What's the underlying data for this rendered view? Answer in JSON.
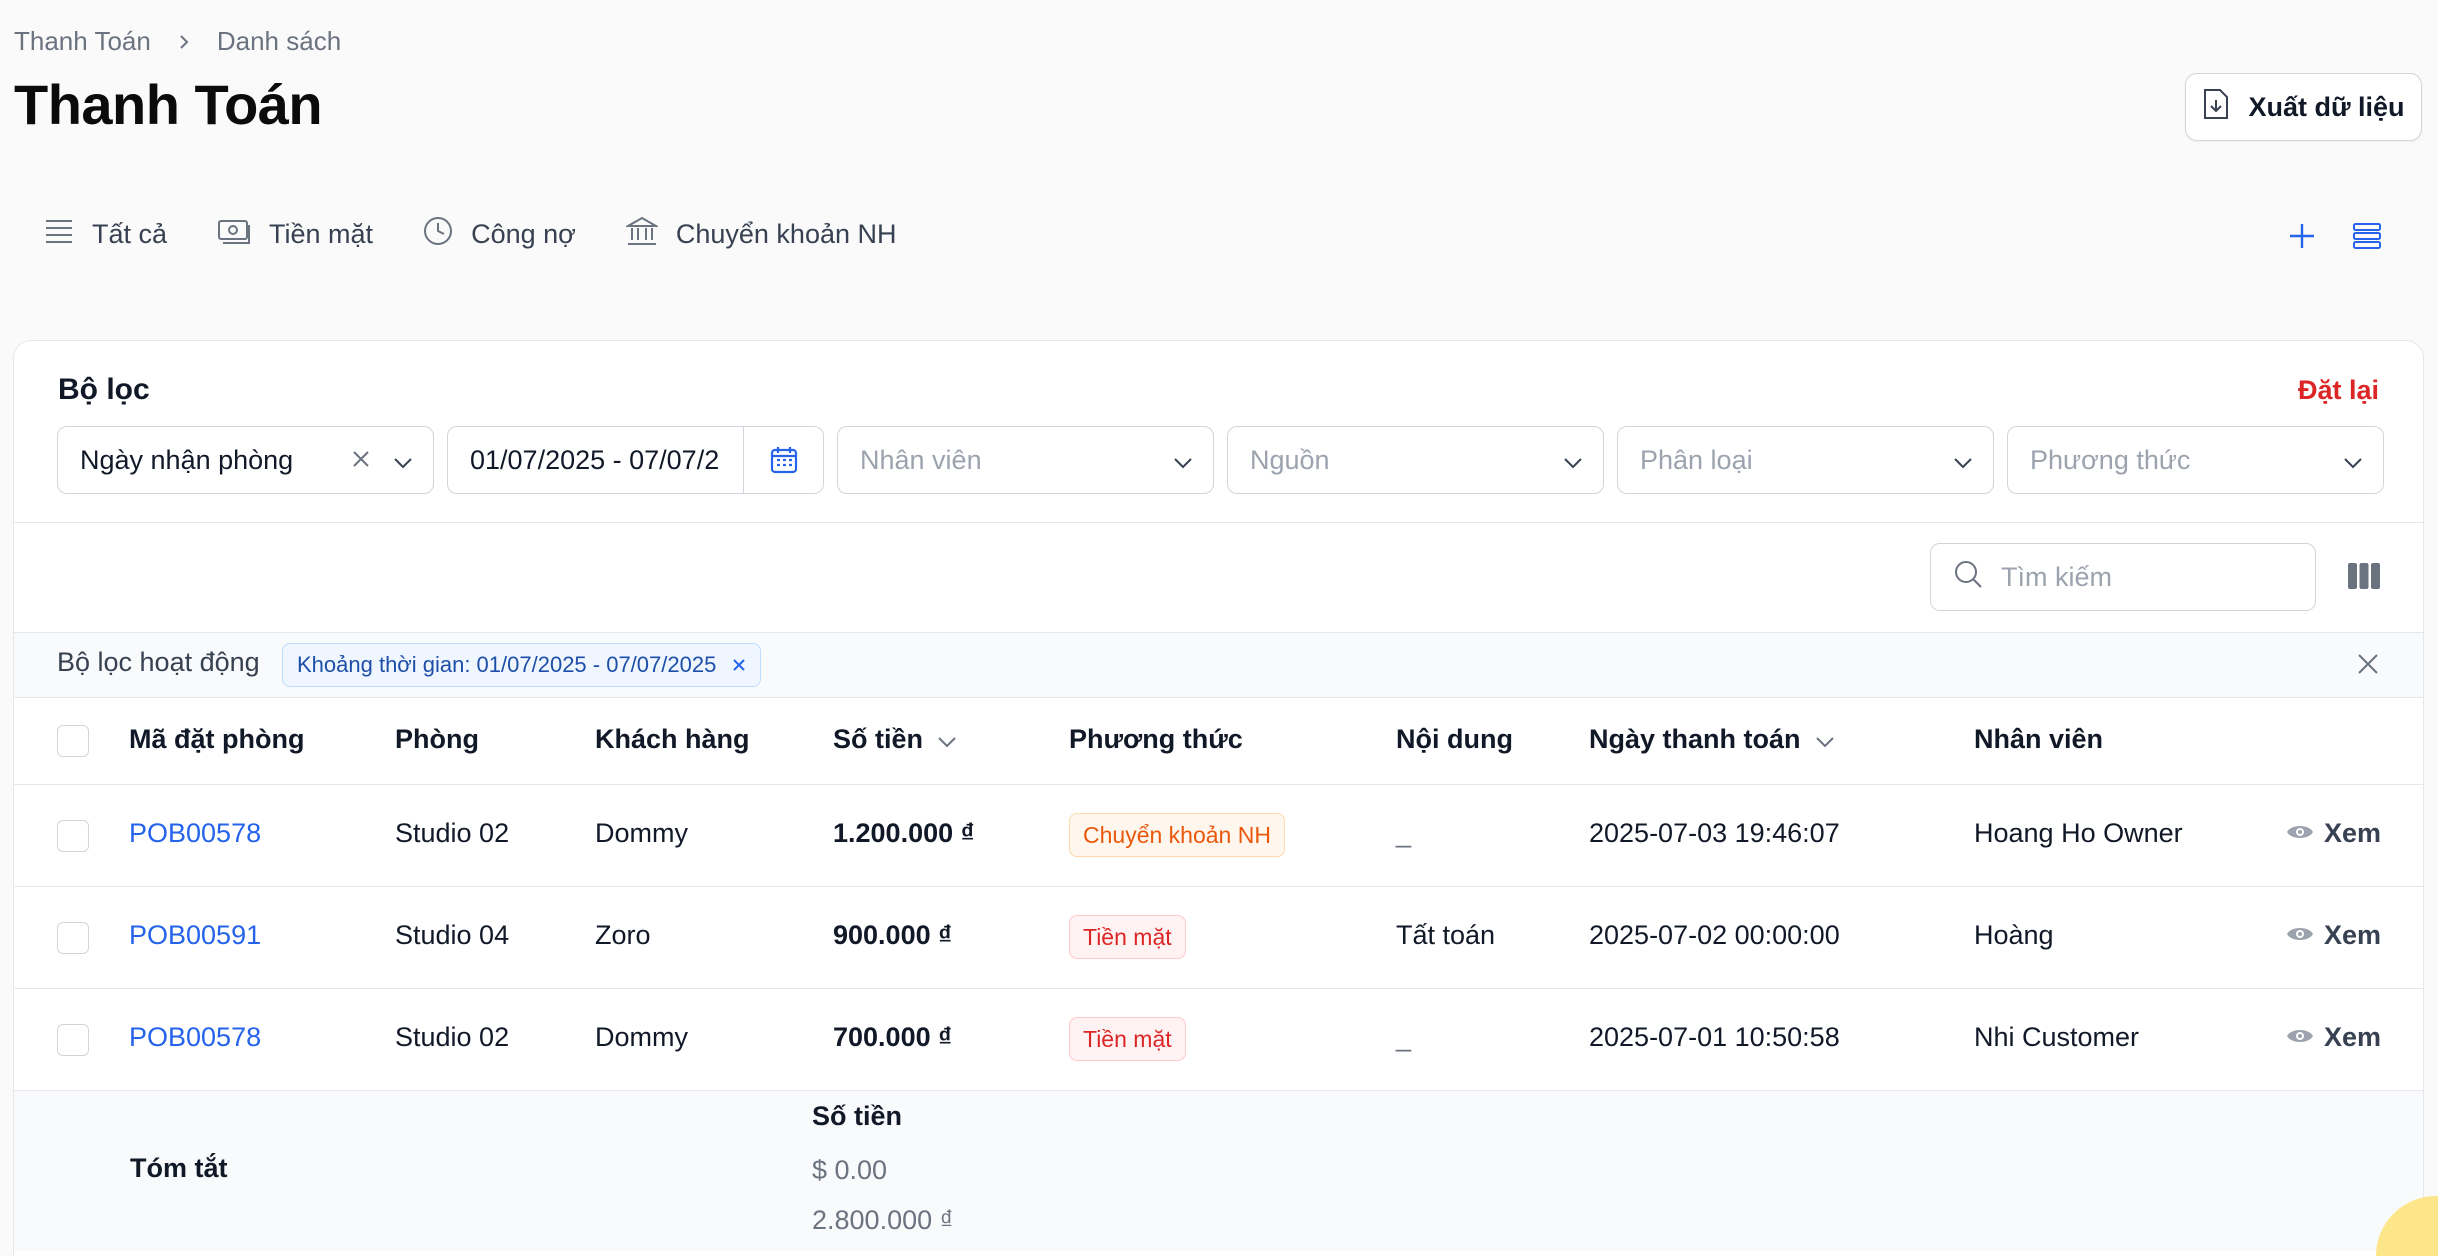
{
  "breadcrumb": {
    "root": "Thanh Toán",
    "current": "Danh sách"
  },
  "page_title": "Thanh Toán",
  "export_label": "Xuất dữ liệu",
  "tabs": [
    {
      "label": "Tất cả",
      "icon": "list-icon"
    },
    {
      "label": "Tiền mặt",
      "icon": "cash-icon"
    },
    {
      "label": "Công nợ",
      "icon": "clock-icon"
    },
    {
      "label": "Chuyển khoản NH",
      "icon": "bank-icon"
    }
  ],
  "filter": {
    "title": "Bộ lọc",
    "reset": "Đặt lại",
    "date_type": "Ngày nhận phòng",
    "date_range": "01/07/2025 - 07/07/2",
    "staff_placeholder": "Nhân viên",
    "source_placeholder": "Nguồn",
    "category_placeholder": "Phân loại",
    "method_placeholder": "Phương thức"
  },
  "search": {
    "placeholder": "Tìm kiếm"
  },
  "active_filters": {
    "label": "Bộ lọc hoạt động",
    "chip": "Khoảng thời gian: 01/07/2025 - 07/07/2025"
  },
  "table": {
    "headers": {
      "code": "Mã đặt phòng",
      "room": "Phòng",
      "customer": "Khách hàng",
      "amount": "Số tiền",
      "method": "Phương thức",
      "content": "Nội dung",
      "date": "Ngày thanh toán",
      "staff": "Nhân viên"
    },
    "view_label": "Xem",
    "rows": [
      {
        "code": "POB00578",
        "room": "Studio 02",
        "customer": "Dommy",
        "amount": "1.200.000 ₫",
        "method": "Chuyển khoản NH",
        "content": "_",
        "date": "2025-07-03 19:46:07",
        "staff": "Hoang Ho Owner"
      },
      {
        "code": "POB00591",
        "room": "Studio 04",
        "customer": "Zoro",
        "amount": "900.000 ₫",
        "method": "Tiền mặt",
        "content": "Tất toán",
        "date": "2025-07-02 00:00:00",
        "staff": "Hoàng"
      },
      {
        "code": "POB00578",
        "room": "Studio 02",
        "customer": "Dommy",
        "amount": "700.000 ₫",
        "method": "Tiền mặt",
        "content": "_",
        "date": "2025-07-01 10:50:58",
        "staff": "Nhi Customer"
      }
    ]
  },
  "summary": {
    "label": "Tóm tắt",
    "column": "Số tiền",
    "usd": "$ 0.00",
    "vnd": "2.800.000 ₫"
  },
  "colors": {
    "accent": "#2563eb",
    "danger": "#dc2626",
    "transfer_badge": "#ea580c",
    "background": "#fafafa"
  }
}
